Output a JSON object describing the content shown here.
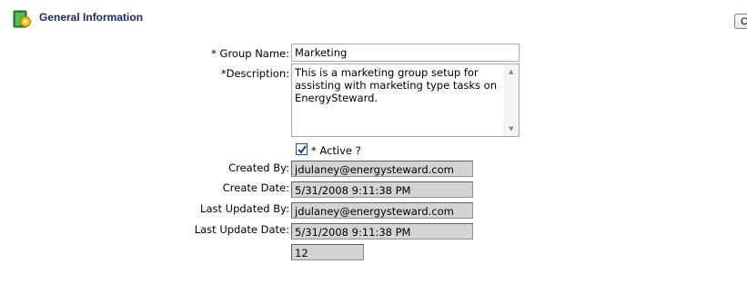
{
  "header": {
    "title": "General Information",
    "icon": "group-settings-icon"
  },
  "form": {
    "group_name": {
      "label": "* Group Name:",
      "value": "Marketing"
    },
    "description": {
      "label": "*Description:",
      "value": "This is a marketing group setup for assisting with marketing type tasks on EnergySteward."
    },
    "active": {
      "label": "* Active ?",
      "checked": true
    },
    "created_by": {
      "label": "Created By:",
      "value": "jdulaney@energysteward.com"
    },
    "create_date": {
      "label": "Create Date:",
      "value": "5/31/2008 9:11:38 PM"
    },
    "last_updated_by": {
      "label": "Last Updated By:",
      "value": "jdulaney@energysteward.com"
    },
    "last_update_date": {
      "label": "Last Update Date:",
      "value": "5/31/2008 9:11:38 PM"
    },
    "id_field": {
      "value": "12"
    }
  },
  "colors": {
    "title": "#1a2a6b",
    "readonly_bg": "#d4d4d4",
    "checkbox_border": "#1c5180"
  }
}
